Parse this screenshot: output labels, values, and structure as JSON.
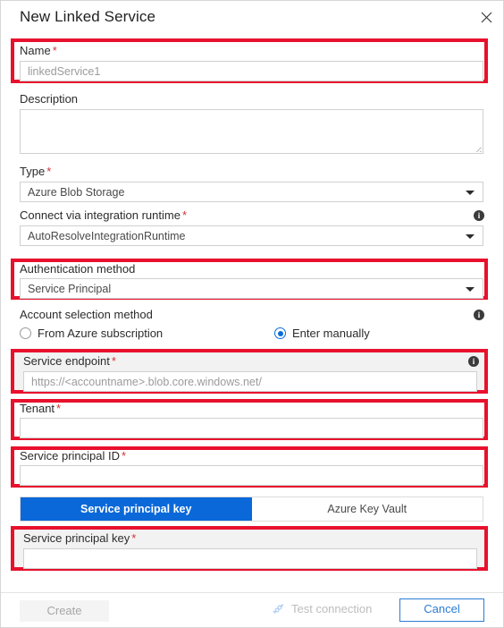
{
  "dialog": {
    "title": "New Linked Service",
    "close_icon": "close-icon"
  },
  "fields": {
    "name": {
      "label": "Name",
      "required": "*",
      "value": "linkedService1",
      "highlighted": true
    },
    "description": {
      "label": "Description",
      "value": ""
    },
    "type": {
      "label": "Type",
      "required": "*",
      "value": "Azure Blob Storage"
    },
    "integration_runtime": {
      "label": "Connect via integration runtime",
      "required": "*",
      "value": "AutoResolveIntegrationRuntime",
      "info_icon": "info-icon"
    },
    "auth_method": {
      "label": "Authentication method",
      "value": "Service Principal",
      "highlighted": true
    },
    "account_selection": {
      "label": "Account selection method",
      "info_icon": "info-icon",
      "options": [
        {
          "label": "From Azure subscription",
          "selected": false
        },
        {
          "label": "Enter manually",
          "selected": true
        }
      ]
    },
    "service_endpoint": {
      "label": "Service endpoint",
      "required": "*",
      "value": "",
      "placeholder": "https://<accountname>.blob.core.windows.net/",
      "info_icon": "info-icon",
      "highlighted": true
    },
    "tenant": {
      "label": "Tenant",
      "required": "*",
      "value": "",
      "highlighted": true
    },
    "service_principal_id": {
      "label": "Service principal ID",
      "required": "*",
      "value": "",
      "highlighted": true
    },
    "credential_pivot": {
      "tabs": [
        {
          "label": "Service principal key",
          "active": true
        },
        {
          "label": "Azure Key Vault",
          "active": false
        }
      ]
    },
    "service_principal_key": {
      "label": "Service principal key",
      "required": "*",
      "value": "",
      "highlighted": true
    }
  },
  "footer": {
    "create_label": "Create",
    "test_connection_label": "Test connection",
    "test_connection_icon": "plug-connector-icon",
    "cancel_label": "Cancel"
  },
  "colors": {
    "accent_blue": "#0a68d8",
    "highlight_red": "#e8112d",
    "required_red": "#d13438",
    "cancel_border": "#2b7cd3"
  }
}
